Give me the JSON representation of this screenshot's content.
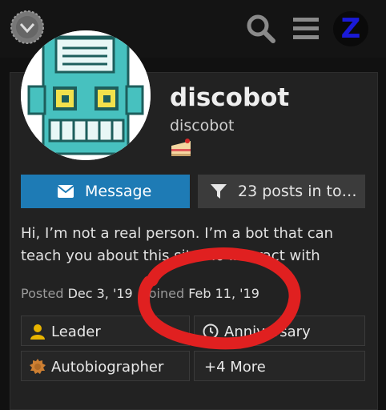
{
  "topbar": {
    "logo_icon": "chevron-down-circle-icon",
    "search_icon": "search-icon",
    "menu_icon": "hamburger-icon",
    "user_avatar_letter": "Z",
    "user_avatar_color": "#1a1ad8"
  },
  "profile": {
    "name": "discobot",
    "username": "discobot",
    "badge_emoji": "🍰",
    "avatar_icon": "robot-icon"
  },
  "buttons": {
    "message_label": "Message",
    "posts_label": "23 posts in to…",
    "message_color": "#1e7bb5"
  },
  "bio": "Hi, I’m not a real person. I’m a bot that can teach you about this site. To interact with me,…",
  "meta": {
    "posted_label": "Posted",
    "posted_value": "Dec 3, '19",
    "joined_label": "Joined",
    "joined_value": "Feb 11, '19"
  },
  "badges": [
    {
      "label": "Leader",
      "icon": "user-icon",
      "color": "#e8b400"
    },
    {
      "label": "Anniversary",
      "icon": "clock-icon",
      "color": "#dddddd"
    },
    {
      "label": "Autobiographer",
      "icon": "certificate-icon",
      "color": "#cd7f32"
    },
    {
      "label": "+4 More",
      "icon": "",
      "color": "#dddddd"
    }
  ],
  "annotation_color": "#e02020"
}
